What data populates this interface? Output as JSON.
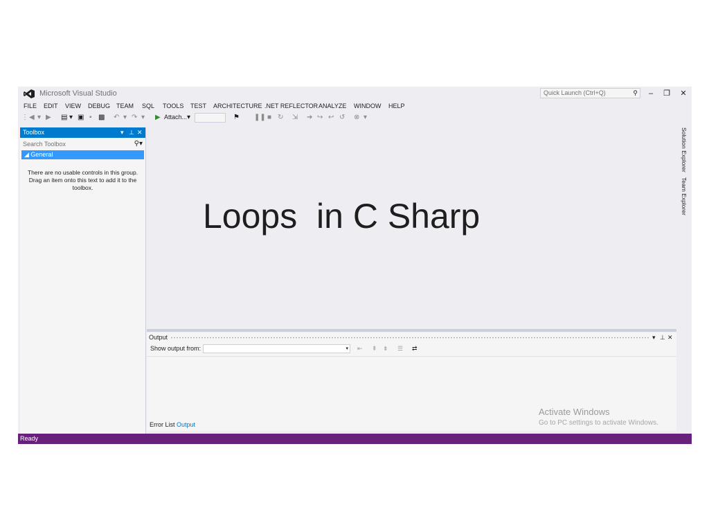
{
  "window": {
    "title": "Microsoft Visual Studio",
    "quick_launch_placeholder": "Quick Launch (Ctrl+Q)"
  },
  "menu": [
    "FILE",
    "EDIT",
    "VIEW",
    "DEBUG",
    "TEAM",
    "SQL",
    "TOOLS",
    "TEST",
    "ARCHITECTURE",
    ".NET REFLECTOR",
    "ANALYZE",
    "WINDOW",
    "HELP"
  ],
  "toolbar": {
    "attach_label": "Attach..."
  },
  "toolbox": {
    "title": "Toolbox",
    "search_placeholder": "Search Toolbox",
    "group": "General",
    "empty_message": "There are no usable controls in this group. Drag an item onto this text to add it to the toolbox."
  },
  "editor": {
    "overlay_title": "Loops  in C Sharp"
  },
  "side_tabs": [
    "Solution Explorer",
    "Team Explorer"
  ],
  "output": {
    "title": "Output",
    "show_output_label": "Show output from:"
  },
  "bottom_tabs": {
    "error_list": "Error List",
    "output": "Output"
  },
  "watermark": {
    "line1": "Activate Windows",
    "line2": "Go to PC settings to activate Windows."
  },
  "status": {
    "text": "Ready"
  },
  "colors": {
    "accent": "#007acc",
    "status_bar": "#68217a",
    "selected_group": "#3399ff"
  }
}
